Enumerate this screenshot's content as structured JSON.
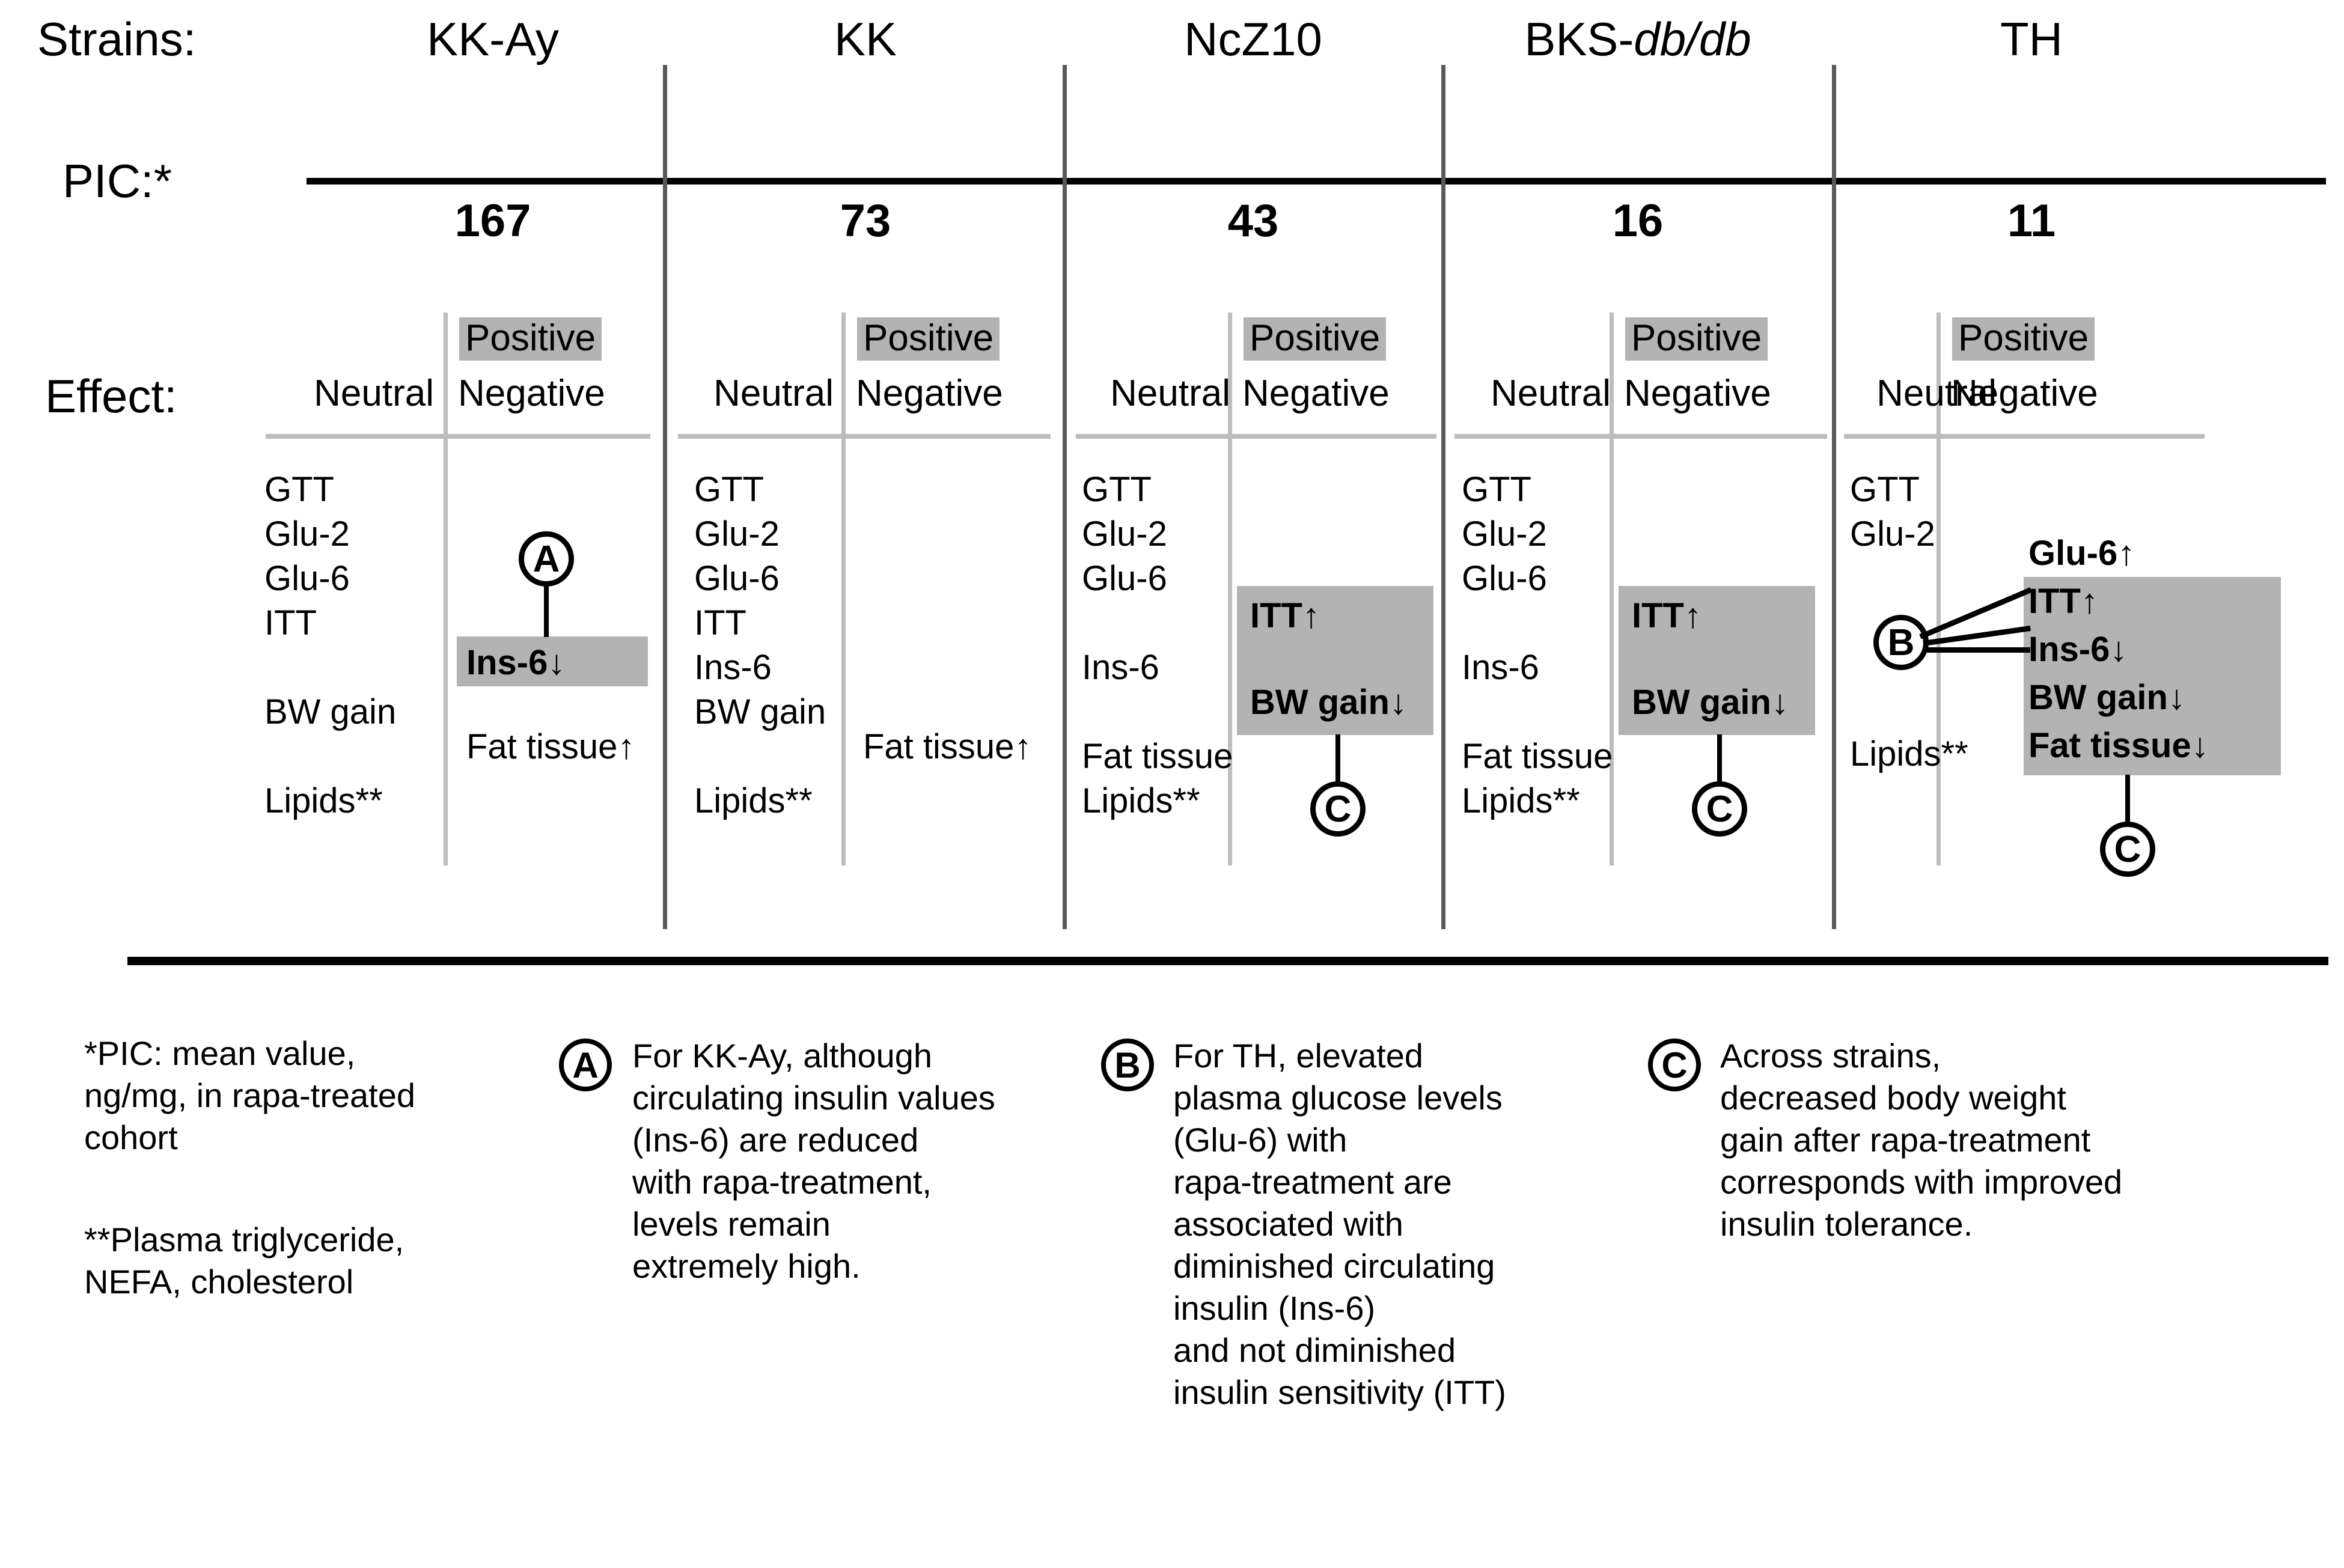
{
  "row_labels": {
    "strains": "Strains:",
    "pic": "PIC:*",
    "effect": "Effect:"
  },
  "effect_headers": {
    "neutral": "Neutral",
    "positive": "Positive",
    "negative": "Negative"
  },
  "colors": {
    "highlight_gray": "#b3b3b3",
    "divider_dark": "#595959",
    "divider_light": "#bdbdbd",
    "rule_black": "#000000"
  },
  "columns": [
    {
      "strain": "KK-Ay",
      "strain_italic_part": "",
      "pic": "167",
      "neutral": [
        "GTT",
        "Glu-2",
        "Glu-6",
        "ITT",
        "",
        "BW gain",
        "",
        "Lipids**"
      ],
      "negative": [
        {
          "label": "Ins-6",
          "arrow": "↓",
          "bold": true,
          "highlight": true
        },
        {
          "label": "Fat tissue",
          "arrow": "↑",
          "bold": false,
          "highlight": false
        }
      ],
      "callout": "A"
    },
    {
      "strain": "KK",
      "strain_italic_part": "",
      "pic": "73",
      "neutral": [
        "GTT",
        "Glu-2",
        "Glu-6",
        "ITT",
        "Ins-6",
        "BW gain",
        "",
        "Lipids**"
      ],
      "negative": [
        {
          "label": "Fat tissue",
          "arrow": "↑",
          "bold": false,
          "highlight": false
        }
      ],
      "callout": ""
    },
    {
      "strain": "NcZ10",
      "strain_italic_part": "",
      "pic": "43",
      "neutral": [
        "GTT",
        "Glu-2",
        "Glu-6",
        "",
        "Ins-6",
        "",
        "Fat tissue",
        "Lipids**"
      ],
      "negative": [
        {
          "label": "ITT",
          "arrow": "↑",
          "bold": true,
          "highlight": true
        },
        {
          "label": "BW gain",
          "arrow": "↓",
          "bold": true,
          "highlight": true
        }
      ],
      "callout": "C"
    },
    {
      "strain": "BKS-",
      "strain_italic_part": "db/db",
      "pic": "16",
      "neutral": [
        "GTT",
        "Glu-2",
        "Glu-6",
        "",
        "Ins-6",
        "",
        "Fat tissue",
        "Lipids**"
      ],
      "negative": [
        {
          "label": "ITT",
          "arrow": "↑",
          "bold": true,
          "highlight": true
        },
        {
          "label": "BW gain",
          "arrow": "↓",
          "bold": true,
          "highlight": true
        }
      ],
      "callout": "C"
    },
    {
      "strain": "TH",
      "strain_italic_part": "",
      "pic": "11",
      "neutral": [
        "GTT",
        "Glu-2",
        "",
        "",
        "",
        "",
        "",
        "Lipids**"
      ],
      "negative": [
        {
          "label": "Glu-6",
          "arrow": "↑",
          "bold": true,
          "highlight": false
        },
        {
          "label": "ITT",
          "arrow": "↑",
          "bold": true,
          "highlight": true
        },
        {
          "label": "Ins-6",
          "arrow": "↓",
          "bold": true,
          "highlight": true
        },
        {
          "label": "BW gain",
          "arrow": "↓",
          "bold": true,
          "highlight": true
        },
        {
          "label": "Fat tissue",
          "arrow": "↓",
          "bold": true,
          "highlight": true
        }
      ],
      "callout": "B",
      "callout2": "C"
    }
  ],
  "footnotes": {
    "pic_note": "*PIC: mean value,\nng/mg, in rapa-treated\ncohort",
    "lipids_note": "**Plasma triglyceride,\nNEFA, cholesterol"
  },
  "notes": [
    {
      "letter": "A",
      "text": "For KK-Ay, although\ncirculating insulin values\n(Ins-6) are reduced\nwith rapa-treatment,\nlevels remain\nextremely high."
    },
    {
      "letter": "B",
      "text": "For TH, elevated\nplasma glucose levels\n(Glu-6) with\nrapa-treatment are\nassociated with\ndiminished circulating\ninsulin (Ins-6)\nand not diminished\ninsulin sensitivity (ITT)"
    },
    {
      "letter": "C",
      "text": "Across strains,\ndecreased body weight\ngain after rapa-treatment\ncorresponds with improved\ninsulin tolerance."
    }
  ]
}
